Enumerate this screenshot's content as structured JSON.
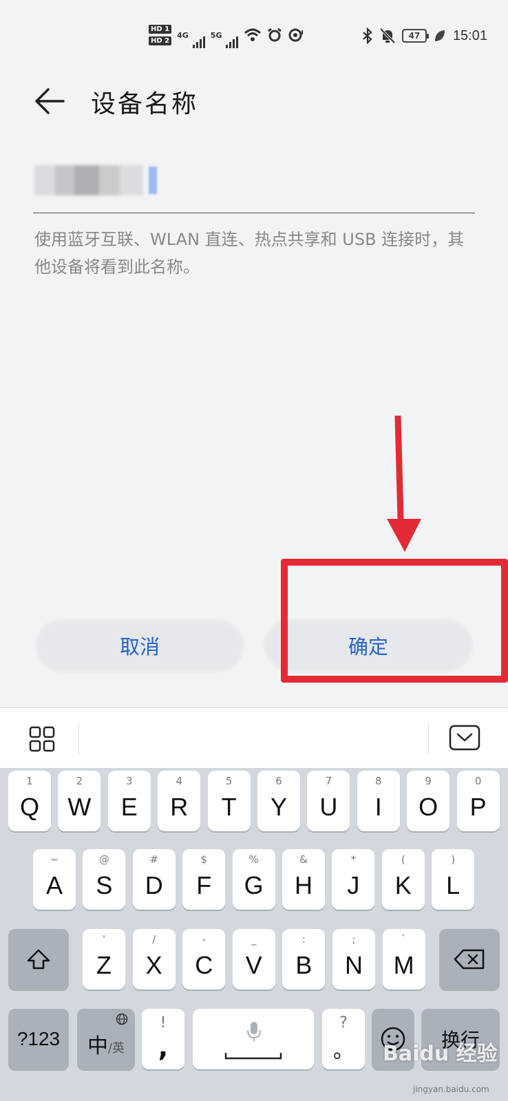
{
  "status_bar": {
    "sim1": "HD 1",
    "sim2": "HD 2",
    "network1": "4G",
    "network2": "5G",
    "battery": "47",
    "time": "15:01",
    "icons": [
      "signal-icon",
      "wifi-icon",
      "alarm-icon",
      "hotspot-icon",
      "bluetooth-icon",
      "mute-icon",
      "battery-icon",
      "eco-leaf-icon"
    ]
  },
  "title_bar": {
    "title": "设备名称",
    "back_icon": "back-arrow-icon"
  },
  "name_field": {
    "value": "",
    "blurred": true
  },
  "description": "使用蓝牙互联、WLAN 直连、热点共享和 USB 连接时，其他设备将看到此名称。",
  "buttons": {
    "cancel": "取消",
    "confirm": "确定"
  },
  "annotation": {
    "arrow_color": "#e32b35",
    "box_color": "#e32b35"
  },
  "keyboard": {
    "toolbar": {
      "menu_icon": "grid-menu-icon",
      "hide_icon": "collapse-keyboard-icon"
    },
    "row1": [
      {
        "hint": "1",
        "key": "Q"
      },
      {
        "hint": "2",
        "key": "W"
      },
      {
        "hint": "3",
        "key": "E"
      },
      {
        "hint": "4",
        "key": "R"
      },
      {
        "hint": "5",
        "key": "T"
      },
      {
        "hint": "6",
        "key": "Y"
      },
      {
        "hint": "7",
        "key": "U"
      },
      {
        "hint": "8",
        "key": "I"
      },
      {
        "hint": "9",
        "key": "O"
      },
      {
        "hint": "0",
        "key": "P"
      }
    ],
    "row2": [
      {
        "hint": "~",
        "key": "A"
      },
      {
        "hint": "@",
        "key": "S"
      },
      {
        "hint": "#",
        "key": "D"
      },
      {
        "hint": "$",
        "key": "F"
      },
      {
        "hint": "%",
        "key": "G"
      },
      {
        "hint": "&",
        "key": "H"
      },
      {
        "hint": "*",
        "key": "J"
      },
      {
        "hint": "(",
        "key": "K"
      },
      {
        "hint": ")",
        "key": "L"
      }
    ],
    "row3": [
      {
        "hint": "'",
        "key": "Z"
      },
      {
        "hint": "/",
        "key": "X"
      },
      {
        "hint": "-",
        "key": "C"
      },
      {
        "hint": "_",
        "key": "V"
      },
      {
        "hint": ":",
        "key": "B"
      },
      {
        "hint": ";",
        "key": "N"
      },
      {
        "hint": "`",
        "key": "M"
      }
    ],
    "shift_icon": "shift-icon",
    "backspace_icon": "backspace-icon",
    "symbols_label": "?123",
    "lang_main": "中",
    "lang_sub": "/英",
    "globe_icon": "globe-icon",
    "comma_hint": "!",
    "comma_key": ",",
    "space_icon": "microphone-icon",
    "period_hint": "?",
    "period_key": "。",
    "emoji_icon": "emoji-icon",
    "enter_label": "换行"
  },
  "watermark": {
    "logo": "Baidu 经验",
    "url": "jingyan.baidu.com"
  }
}
